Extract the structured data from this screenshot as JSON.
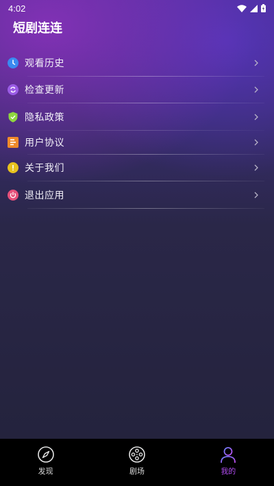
{
  "status_bar": {
    "time": "4:02"
  },
  "app": {
    "title": "短剧连连"
  },
  "menu": {
    "items": [
      {
        "label": "观看历史",
        "icon": "clock-icon",
        "color": "#3a8af0"
      },
      {
        "label": "检查更新",
        "icon": "refresh-icon",
        "color": "#9b5ce6"
      },
      {
        "label": "隐私政策",
        "icon": "shield-icon",
        "color": "#8fd640"
      },
      {
        "label": "用户协议",
        "icon": "document-icon",
        "color": "#f08a2a"
      },
      {
        "label": "关于我们",
        "icon": "info-icon",
        "color": "#e8c21e"
      },
      {
        "label": "退出应用",
        "icon": "power-icon",
        "color": "#e6507a"
      }
    ]
  },
  "bottom_nav": {
    "items": [
      {
        "label": "发现",
        "icon": "compass-icon"
      },
      {
        "label": "剧场",
        "icon": "film-reel-icon"
      },
      {
        "label": "我的",
        "icon": "person-icon",
        "active": true
      }
    ],
    "active_color": "#b04cf0"
  }
}
